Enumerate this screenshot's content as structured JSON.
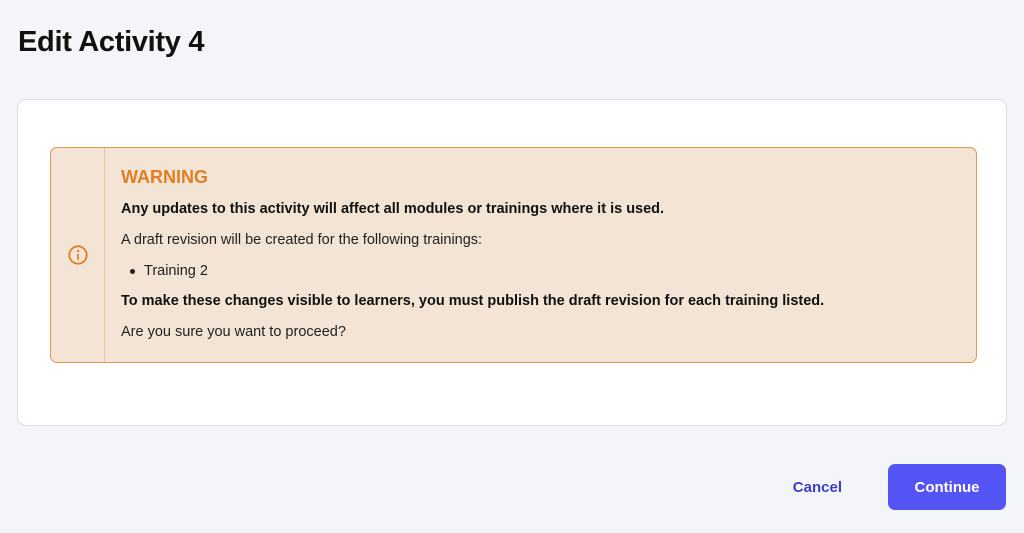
{
  "page": {
    "title": "Edit Activity 4"
  },
  "alert": {
    "icon": "info-circle-icon",
    "color": "#e07f22",
    "background": "#f3e4d6",
    "title": "WARNING",
    "line1": "Any updates to this activity will affect all modules or trainings where it is used.",
    "line2": "A draft revision will be created for the following trainings:",
    "trainings": [
      "Training 2"
    ],
    "line3": "To make these changes visible to learners, you must publish the draft revision for each training listed.",
    "line4": "Are you sure you want to proceed?"
  },
  "actions": {
    "cancel_label": "Cancel",
    "continue_label": "Continue",
    "primary_color": "#5454f4"
  }
}
